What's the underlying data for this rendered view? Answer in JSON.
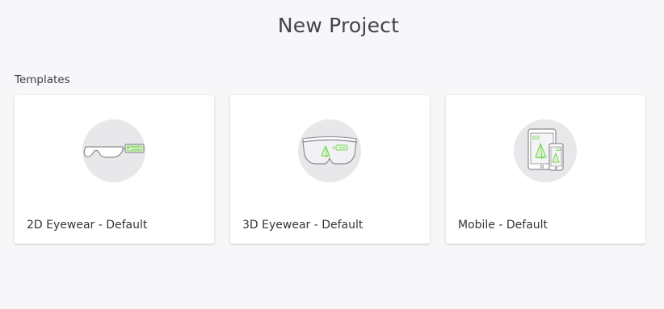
{
  "header": {
    "title": "New Project"
  },
  "templates": {
    "section_label": "Templates",
    "items": [
      {
        "label": "2D Eyewear - Default",
        "icon": "glasses-2d-icon"
      },
      {
        "label": "3D Eyewear - Default",
        "icon": "glasses-3d-icon"
      },
      {
        "label": "Mobile - Default",
        "icon": "mobile-devices-icon"
      }
    ]
  },
  "colors": {
    "background": "#f7f7f9",
    "card": "#ffffff",
    "thumb_circle": "#e8e7ea",
    "accent_green": "#7dd35a",
    "outline_gray": "#8a8a90"
  }
}
